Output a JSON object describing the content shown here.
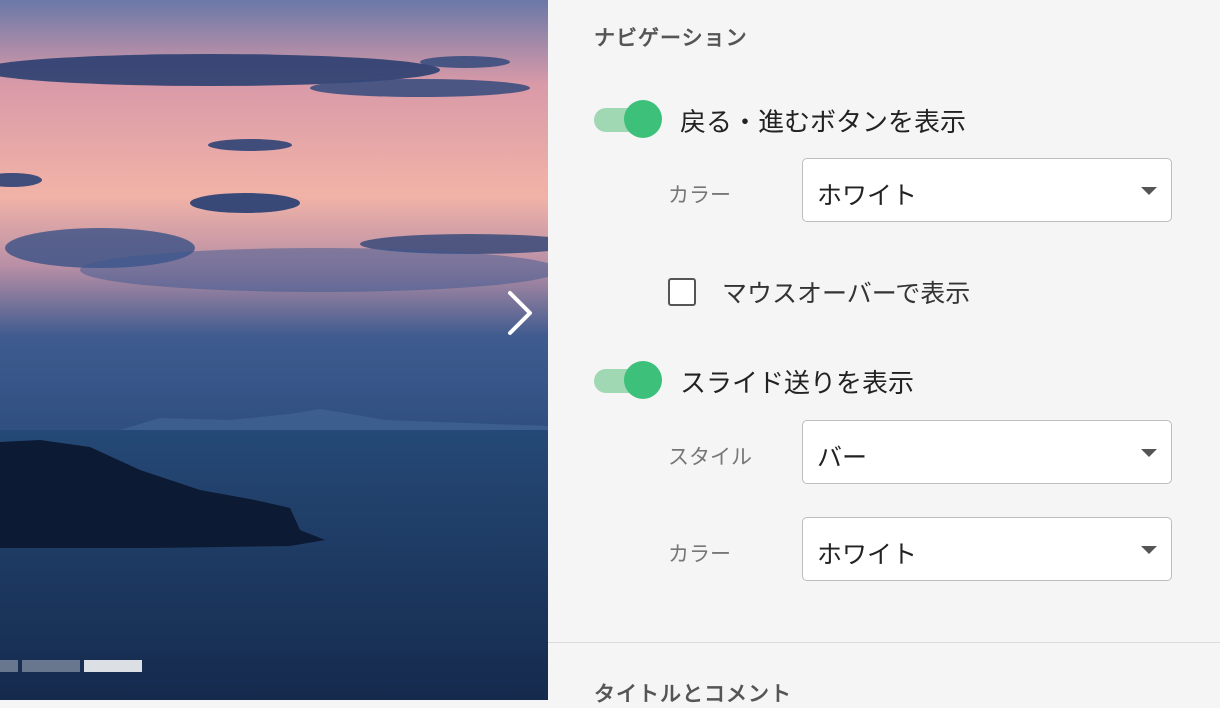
{
  "colors": {
    "accent": "#3cc07a",
    "accent_track": "#9fd8b3"
  },
  "preview": {
    "next_icon": "chevron-right-icon",
    "indicator": {
      "style": "bar",
      "segments": 3,
      "active_index": 2
    }
  },
  "navigation": {
    "title": "ナビゲーション",
    "arrows": {
      "toggle_label": "戻る・進むボタンを表示",
      "enabled": true,
      "color": {
        "label": "カラー",
        "value": "ホワイト"
      },
      "hover_checkbox": {
        "label": "マウスオーバーで表示",
        "checked": false
      }
    },
    "slides": {
      "toggle_label": "スライド送りを表示",
      "enabled": true,
      "style": {
        "label": "スタイル",
        "value": "バー"
      },
      "color": {
        "label": "カラー",
        "value": "ホワイト"
      }
    }
  },
  "next_section": {
    "title": "タイトルとコメント"
  }
}
